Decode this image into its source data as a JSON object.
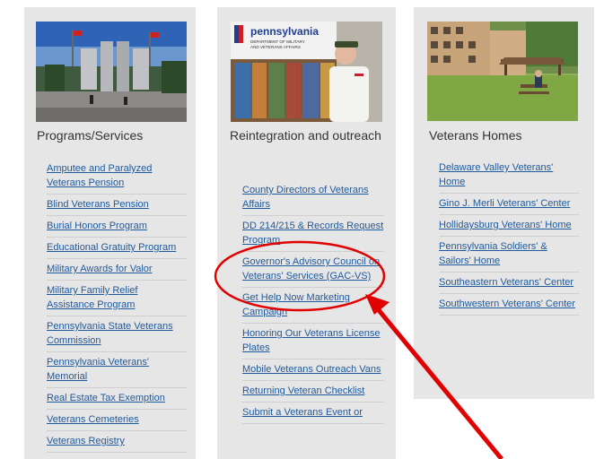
{
  "columns": [
    {
      "heading": "Programs/Services",
      "links": [
        "Amputee and Paralyzed Veterans Pension",
        "Blind Veterans Pension",
        "Burial Honors Program",
        "Educational Gratuity Program",
        "Military Awards for Valor",
        "Military Family Relief Assistance Program",
        "Pennsylvania State Veterans Commission",
        "Pennsylvania Veterans' Memorial",
        "Real Estate Tax Exemption",
        "Veterans Cemeteries",
        "Veterans Registry"
      ]
    },
    {
      "heading": "Reintegration and outreach",
      "photo_text": {
        "brand": "pennsylvania",
        "sub1": "DEPARTMENT OF MILITARY",
        "sub2": "AND VETERANS AFFAIRS"
      },
      "links": [
        "County Directors of Veterans Affairs",
        "DD 214/215 & Records Request Program",
        "Governor's Advisory Council on Veterans' Services (GAC-VS)",
        "Get Help Now Marketing Campaign",
        "Honoring Our Veterans License Plates",
        "Mobile Veterans Outreach Vans",
        "Returning Veteran Checklist",
        "Submit a Veterans Event or"
      ]
    },
    {
      "heading": "Veterans Homes",
      "links": [
        "Delaware Valley Veterans' Home",
        "Gino J. Merli Veterans' Center",
        "Hollidaysburg Veterans' Home",
        "Pennsylvania Soldiers' & Sailors' Home",
        "Southeastern Veterans' Center",
        "Southwestern Veterans' Center"
      ]
    }
  ],
  "colors": {
    "card_bg": "#e6e6e6",
    "link": "#1f5a9c",
    "heading": "#333333",
    "annotation": "#e00000"
  },
  "annotation": {
    "highlight": "circle around Governor's Advisory Council on Veterans' Services (GAC-VS)",
    "pointer": "red arrow"
  }
}
